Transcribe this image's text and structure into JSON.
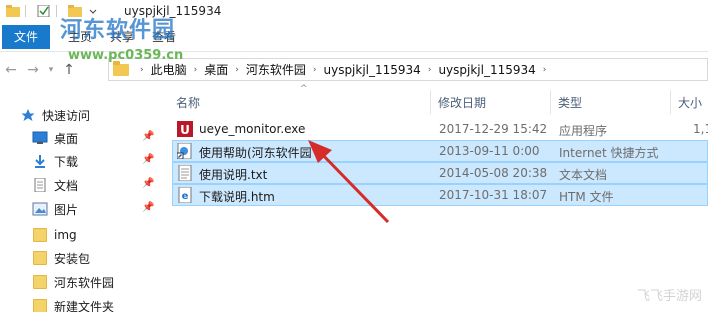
{
  "window": {
    "title": "uyspjkjl_115934"
  },
  "ribbon": {
    "tabs": [
      "文件",
      "主页",
      "共享",
      "查看"
    ]
  },
  "address": {
    "crumbs": [
      "此电脑",
      "桌面",
      "河东软件园",
      "uyspjkjl_115934",
      "uyspjkjl_115934"
    ]
  },
  "columns": {
    "name": "名称",
    "modified": "修改日期",
    "type": "类型",
    "size": "大小"
  },
  "nav": {
    "items": [
      {
        "label": "快速访问",
        "icon": "star-icon",
        "pinned": false
      },
      {
        "label": "桌面",
        "icon": "desktop-icon",
        "pinned": true
      },
      {
        "label": "下载",
        "icon": "download-icon",
        "pinned": true
      },
      {
        "label": "文档",
        "icon": "document-icon",
        "pinned": true
      },
      {
        "label": "图片",
        "icon": "picture-icon",
        "pinned": true
      },
      {
        "label": "img",
        "icon": "folder-icon",
        "pinned": false
      },
      {
        "label": "安装包",
        "icon": "folder-icon",
        "pinned": false
      },
      {
        "label": "河东软件园",
        "icon": "folder-icon",
        "pinned": false
      },
      {
        "label": "新建文件夹",
        "icon": "folder-icon",
        "pinned": false
      }
    ]
  },
  "files": [
    {
      "name": "ueye_monitor.exe",
      "modified": "2017-12-29 15:42",
      "type": "应用程序",
      "size": "1,1",
      "icon": "exe-icon",
      "selected": false
    },
    {
      "name": "使用帮助(河东软件园",
      "modified": "2013-09-11 0:00",
      "type": "Internet 快捷方式",
      "size": "",
      "icon": "shortcut-icon",
      "selected": true
    },
    {
      "name": "使用说明.txt",
      "modified": "2014-05-08 20:38",
      "type": "文本文档",
      "size": "",
      "icon": "text-file-icon",
      "selected": true
    },
    {
      "name": "下载说明.htm",
      "modified": "2017-10-31 18:07",
      "type": "HTM 文件",
      "size": "",
      "icon": "html-file-icon",
      "selected": true
    }
  ],
  "watermark": {
    "logo": "河东软件园",
    "url": "www.pc0359.cn",
    "corner": "飞飞手游网"
  },
  "colors": {
    "accent": "#1979ca",
    "selection": "#cce8ff",
    "arrow": "#d62b2b"
  }
}
